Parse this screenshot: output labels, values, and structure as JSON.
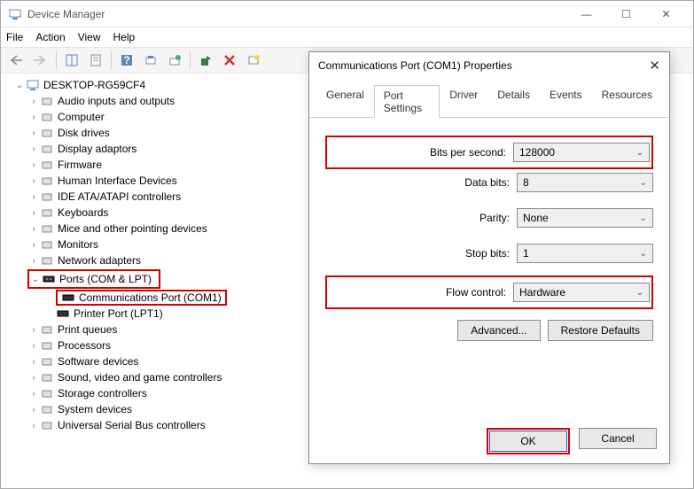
{
  "window": {
    "title": "Device Manager"
  },
  "win_buttons": {
    "min": "—",
    "max": "☐",
    "close": "✕"
  },
  "menu": {
    "file": "File",
    "action": "Action",
    "view": "View",
    "help": "Help"
  },
  "tree": {
    "root": "DESKTOP-RG59CF4",
    "items": [
      "Audio inputs and outputs",
      "Computer",
      "Disk drives",
      "Display adaptors",
      "Firmware",
      "Human Interface Devices",
      "IDE ATA/ATAPI controllers",
      "Keyboards",
      "Mice and other pointing devices",
      "Monitors",
      "Network adapters"
    ],
    "ports": {
      "label": "Ports (COM & LPT)",
      "children": [
        "Communications Port (COM1)",
        "Printer Port (LPT1)"
      ]
    },
    "after": [
      "Print queues",
      "Processors",
      "Software devices",
      "Sound, video and game controllers",
      "Storage controllers",
      "System devices",
      "Universal Serial Bus controllers"
    ]
  },
  "dialog": {
    "title": "Communications Port (COM1) Properties",
    "tabs": [
      "General",
      "Port Settings",
      "Driver",
      "Details",
      "Events",
      "Resources"
    ],
    "active_tab": "Port Settings",
    "fields": {
      "bits_label": "Bits per second:",
      "bits_value": "128000",
      "databits_label": "Data bits:",
      "databits_value": "8",
      "parity_label": "Parity:",
      "parity_value": "None",
      "stopbits_label": "Stop bits:",
      "stopbits_value": "1",
      "flow_label": "Flow control:",
      "flow_value": "Hardware"
    },
    "advanced": "Advanced...",
    "restore": "Restore Defaults",
    "ok": "OK",
    "cancel": "Cancel"
  }
}
